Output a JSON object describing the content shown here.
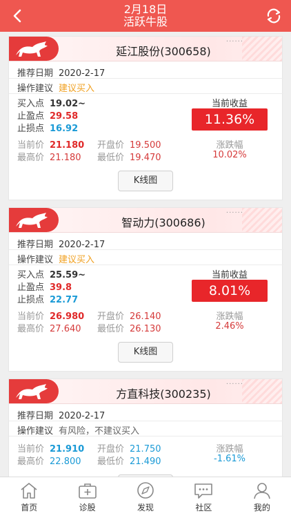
{
  "header": {
    "date": "2月18日",
    "title": "活跃牛股"
  },
  "labels": {
    "rec_date": "推荐日期",
    "advice": "操作建议",
    "buy": "买入点",
    "profit": "止盈点",
    "stop": "止损点",
    "cur": "当前价",
    "open": "开盘价",
    "high": "最高价",
    "low": "最低价",
    "earnings": "当前收益",
    "change": "涨跌幅",
    "kline": "K线图"
  },
  "cards": [
    {
      "title": "延江股份(300658)",
      "date": "2020-2-17",
      "advice": "建议买入",
      "buy": "19.02~",
      "profit": "29.58",
      "stop": "16.92",
      "cur": "21.180",
      "open": "19.500",
      "high": "21.180",
      "low": "19.470",
      "earnings": "11.36%",
      "change": "10.02%"
    },
    {
      "title": "智动力(300686)",
      "date": "2020-2-17",
      "advice": "建议买入",
      "buy": "25.59~",
      "profit": "39.8",
      "stop": "22.77",
      "cur": "26.980",
      "open": "26.140",
      "high": "27.640",
      "low": "26.130",
      "earnings": "8.01%",
      "change": "2.46%"
    },
    {
      "title": "方直科技(300235)",
      "date": "2020-2-17",
      "advice": "有风险，不建议买入",
      "cur": "21.910",
      "open": "21.750",
      "high": "22.800",
      "low": "21.490",
      "change": "-1.61%"
    }
  ],
  "tabs": [
    {
      "label": "首页",
      "icon": "home-icon"
    },
    {
      "label": "诊股",
      "icon": "medical-kit-icon"
    },
    {
      "label": "发现",
      "icon": "compass-icon"
    },
    {
      "label": "社区",
      "icon": "chat-icon"
    },
    {
      "label": "我的",
      "icon": "user-icon"
    }
  ],
  "colors": {
    "header": "#ef5750",
    "red": "#e02a2a",
    "blue": "#1a9ad6",
    "orange": "#f0a020",
    "earnings_box": "#e8262a"
  }
}
